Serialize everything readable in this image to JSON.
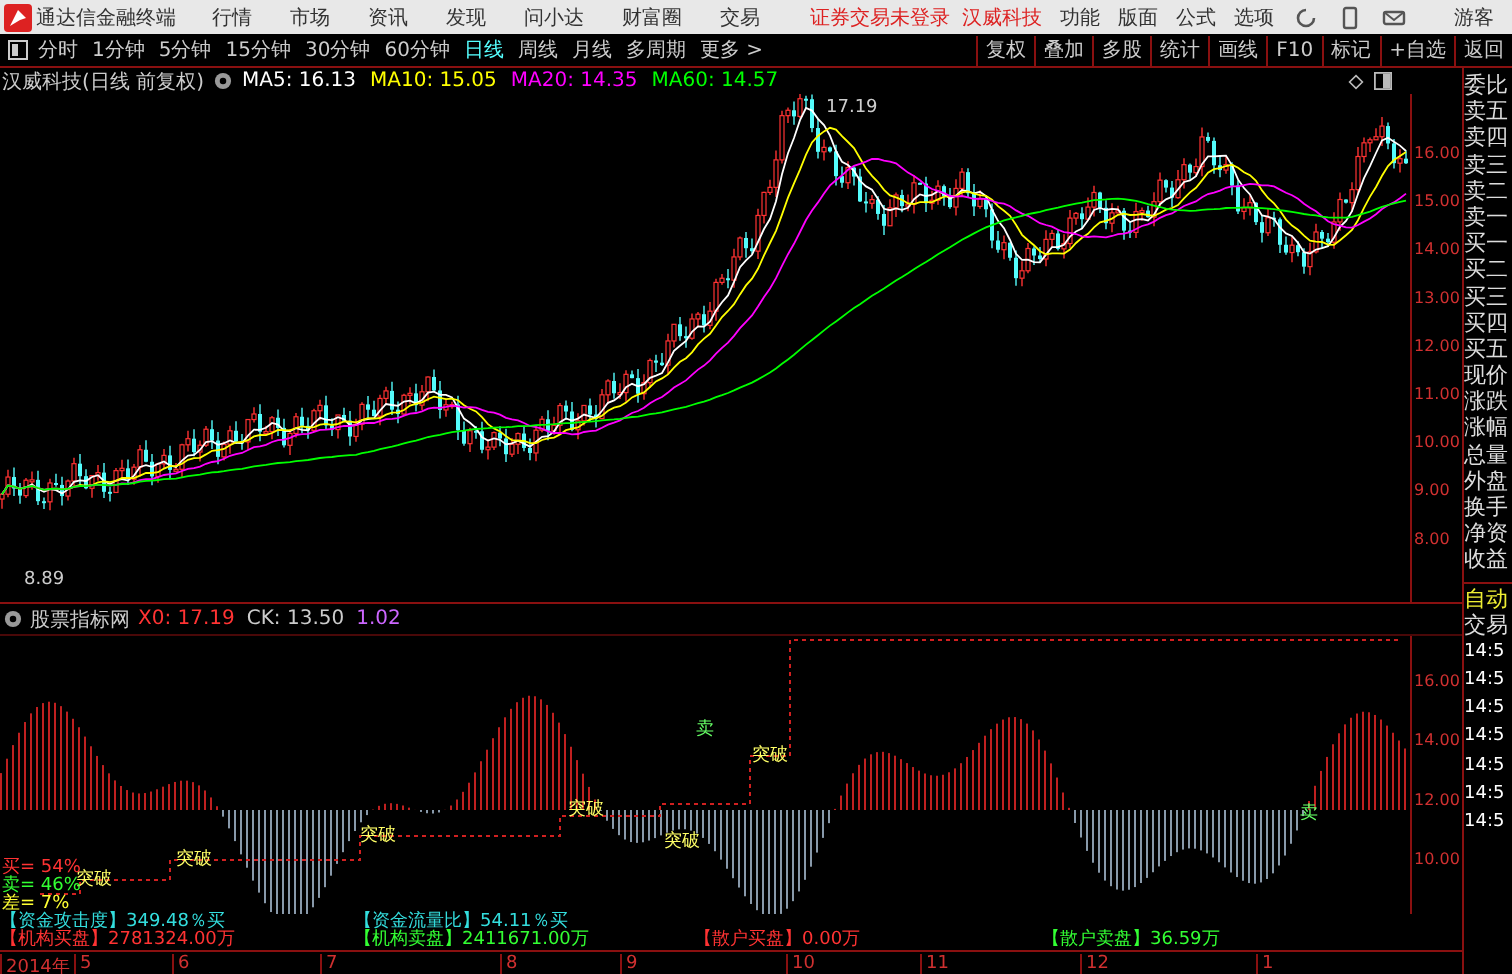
{
  "app": {
    "title": "通达信金融终端"
  },
  "menu": [
    "行情",
    "市场",
    "资讯",
    "发现",
    "问小达",
    "财富圈",
    "交易"
  ],
  "login_status": "证券交易未登录",
  "header_stock": "汉威科技",
  "right_menu": [
    "功能",
    "版面",
    "公式",
    "选项"
  ],
  "user": "游客",
  "periods": [
    {
      "label": "分时",
      "selected": false
    },
    {
      "label": "1分钟",
      "selected": false
    },
    {
      "label": "5分钟",
      "selected": false
    },
    {
      "label": "15分钟",
      "selected": false
    },
    {
      "label": "30分钟",
      "selected": false
    },
    {
      "label": "60分钟",
      "selected": false
    },
    {
      "label": "日线",
      "selected": true
    },
    {
      "label": "周线",
      "selected": false
    },
    {
      "label": "月线",
      "selected": false
    },
    {
      "label": "多周期",
      "selected": false
    },
    {
      "label": "更多 >",
      "selected": false
    }
  ],
  "tools": [
    "复权",
    "叠加",
    "多股",
    "统计",
    "画线",
    "F10",
    "标记",
    "+自选",
    "返回"
  ],
  "main_chart": {
    "title": "汉威科技(日线 前复权)",
    "ma": [
      {
        "label": "MA5: 16.13",
        "color": "#ffffff"
      },
      {
        "label": "MA10: 15.05",
        "color": "#ffff00"
      },
      {
        "label": "MA20: 14.35",
        "color": "#ff00ff"
      },
      {
        "label": "MA60: 14.57",
        "color": "#00ff00"
      }
    ],
    "high_label": "17.19",
    "low_label": "8.89",
    "axis": [
      "16.00",
      "15.00",
      "14.00",
      "13.00",
      "12.00",
      "11.00",
      "10.00",
      "9.00",
      "8.00"
    ]
  },
  "indicator": {
    "name": "股票指标网",
    "values": [
      {
        "label": "X0: 17.19",
        "color": "#ff3333"
      },
      {
        "label": "CK: 13.50",
        "color": "#cccccc"
      },
      {
        "label": "1.02",
        "color": "#cc66ff"
      }
    ],
    "axis": [
      "16.00",
      "14.00",
      "12.00",
      "10.00"
    ],
    "breakouts": [
      "突破",
      "突破",
      "突破",
      "突破",
      "突破",
      "突破"
    ],
    "sells": [
      "卖",
      "卖"
    ],
    "ratios": [
      {
        "label": "买= 54%",
        "color": "#ff3333"
      },
      {
        "label": "卖= 46%",
        "color": "#33ff33"
      },
      {
        "label": "差= 7%",
        "color": "#ffff33"
      }
    ]
  },
  "stats": [
    [
      {
        "label": "【资金攻击度】",
        "value": "349.48％买",
        "color": "#33dddd"
      },
      {
        "label": "【资金流量比】",
        "value": "54.11％买",
        "color": "#33dddd"
      }
    ],
    [
      {
        "label": "【机构买盘】",
        "value": "2781324.00万",
        "color": "#ff3333"
      },
      {
        "label": "【机构卖盘】",
        "value": "2411671.00万",
        "color": "#33ff33"
      },
      {
        "label": "【散户买盘】",
        "value": "0.00万",
        "color": "#ff3333"
      },
      {
        "label": "【散户卖盘】",
        "value": "36.59万",
        "color": "#33ff33"
      }
    ]
  ],
  "dates": [
    "2014年",
    "5",
    "6",
    "7",
    "8",
    "9",
    "10",
    "11",
    "12",
    "1"
  ],
  "side_panel": {
    "quote_labels": [
      "委比",
      "卖五",
      "卖四",
      "卖三",
      "卖二",
      "卖一",
      "买一",
      "买二",
      "买三",
      "买四",
      "买五",
      "现价",
      "涨跌",
      "涨幅",
      "总量",
      "外盘",
      "换手",
      "净资",
      "收益"
    ],
    "mode": "自动",
    "trade_title": "交易",
    "times": [
      "14:5",
      "14:5",
      "14:5",
      "14:5",
      "14:5",
      "14:5",
      "14:5"
    ]
  }
}
